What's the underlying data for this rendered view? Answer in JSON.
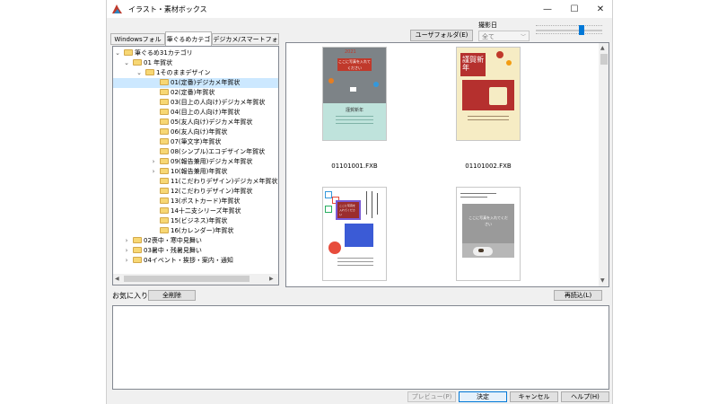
{
  "window": {
    "title": "イラスト・素材ボックス",
    "controls": {
      "minimize": "—",
      "maximize": "☐",
      "close": "✕"
    }
  },
  "tabs": [
    {
      "label": "Windowsフォルダ"
    },
    {
      "label": "筆ぐるめカテゴリ"
    },
    {
      "label": "デジカメ/スマートフォン"
    }
  ],
  "toolbar": {
    "user_folder_label": "ユーザフォルダ(E)",
    "date_label": "撮影日",
    "date_select_value": "全て"
  },
  "tree": [
    {
      "label": "筆ぐるめ31カテゴリ",
      "level": 0,
      "expander": "down"
    },
    {
      "label": "01 年賀状",
      "level": 1,
      "expander": "down"
    },
    {
      "label": "1そのままデザイン",
      "level": 2,
      "expander": "down"
    },
    {
      "label": "01(定番)デジカメ年賀状",
      "level": 3,
      "selected": true
    },
    {
      "label": "02(定番)年賀状",
      "level": 3
    },
    {
      "label": "03(目上の人向け)デジカメ年賀状",
      "level": 3
    },
    {
      "label": "04(目上の人向け)年賀状",
      "level": 3
    },
    {
      "label": "05(友人向け)デジカメ年賀状",
      "level": 3
    },
    {
      "label": "06(友人向け)年賀状",
      "level": 3
    },
    {
      "label": "07(筆文字)年賀状",
      "level": 3
    },
    {
      "label": "08(シンプル)エコデザイン年賀状",
      "level": 3
    },
    {
      "label": "09(報告兼用)デジカメ年賀状",
      "level": 3,
      "expander": "right"
    },
    {
      "label": "10(報告兼用)年賀状",
      "level": 3,
      "expander": "right"
    },
    {
      "label": "11(こだわりデザイン)デジカメ年賀状",
      "level": 3
    },
    {
      "label": "12(こだわりデザイン)年賀状",
      "level": 3
    },
    {
      "label": "13(ポストカード)年賀状",
      "level": 3
    },
    {
      "label": "14十二支シリーズ年賀状",
      "level": 3
    },
    {
      "label": "15(ビジネス)年賀状",
      "level": 3
    },
    {
      "label": "16(カレンダー)年賀状",
      "level": 3
    },
    {
      "label": "02喪中・寒中見舞い",
      "level": 1,
      "expander": "right"
    },
    {
      "label": "03暑中・残暑見舞い",
      "level": 1,
      "expander": "right"
    },
    {
      "label": "04イベント・挨拶・案内・通知",
      "level": 1,
      "expander": "right"
    }
  ],
  "thumbnails": [
    {
      "caption": "01101001.FXB",
      "style": "gray-mint",
      "photo_text": "ここに写真を入れてください",
      "year": "2021",
      "greeting": "謹賀新年"
    },
    {
      "caption": "01101002.FXB",
      "style": "red-cream",
      "greeting": "謹賀新年"
    },
    {
      "caption": "",
      "style": "stamps",
      "photo_text": "ここに写真を入れてください"
    },
    {
      "caption": "",
      "style": "gray-cat",
      "photo_text": "ここに写真を入れてください"
    }
  ],
  "favorites": {
    "label": "お気に入り",
    "clear_all": "全削除",
    "reload": "再読込(L)"
  },
  "footer": {
    "preview": "プレビュー(P)",
    "ok": "決定",
    "cancel": "キャンセル",
    "help": "ヘルプ(H)"
  },
  "colors": {
    "selection": "#cce8ff",
    "folder": "#f7d774",
    "accent": "#0078d7"
  }
}
